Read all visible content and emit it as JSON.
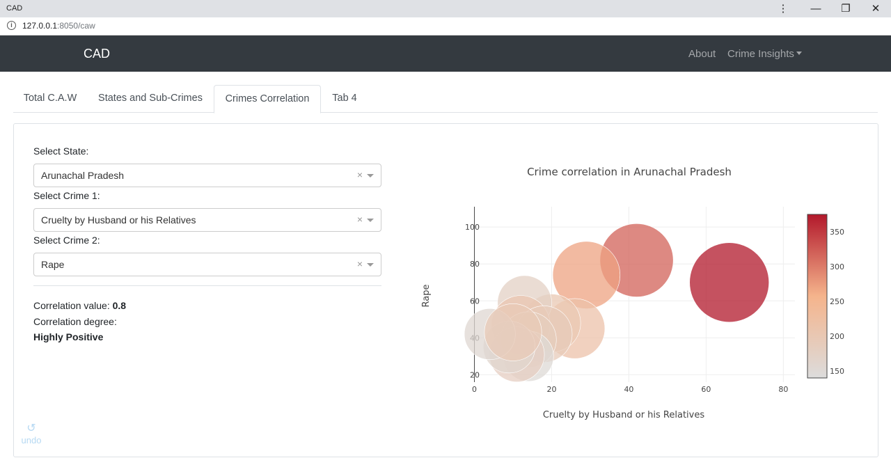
{
  "window": {
    "title": "CAD"
  },
  "browser": {
    "url_host": "127.0.0.1",
    "url_path": ":8050/caw"
  },
  "navbar": {
    "brand": "CAD",
    "about": "About",
    "insights": "Crime Insights"
  },
  "tabs": [
    {
      "label": "Total C.A.W"
    },
    {
      "label": "States and Sub-Crimes"
    },
    {
      "label": "Crimes Correlation"
    },
    {
      "label": "Tab 4"
    }
  ],
  "form": {
    "state_label": "Select State:",
    "state_value": "Arunachal Pradesh",
    "crime1_label": "Select Crime 1:",
    "crime1_value": "Cruelty by Husband or his Relatives",
    "crime2_label": "Select Crime 2:",
    "crime2_value": "Rape",
    "clear_glyph": "×"
  },
  "result": {
    "corr_label": "Correlation value: ",
    "corr_value": "0.8",
    "degree_label": "Correlation degree:",
    "degree_value": "Highly Positive"
  },
  "undo": {
    "label": "undo"
  },
  "chart_data": {
    "type": "scatter",
    "title": "Crime correlation in Arunachal Pradesh",
    "xlabel": "Cruelty by Husband or his Relatives",
    "ylabel": "Rape",
    "xlim": [
      -1,
      83
    ],
    "ylim": [
      16,
      111
    ],
    "xticks": [
      0,
      20,
      40,
      60,
      80
    ],
    "yticks": [
      20,
      40,
      60,
      80,
      100
    ],
    "colorbar": {
      "range": [
        140,
        375
      ],
      "ticks": [
        150,
        200,
        250,
        300,
        350
      ]
    },
    "colorscale": [
      "#dcdcdc",
      "#f5b48c",
      "#b2182b"
    ],
    "points": [
      {
        "x": 66,
        "y": 70,
        "size": 375
      },
      {
        "x": 42,
        "y": 82,
        "size": 320
      },
      {
        "x": 29,
        "y": 74,
        "size": 270
      },
      {
        "x": 26,
        "y": 45,
        "size": 215
      },
      {
        "x": 20,
        "y": 48,
        "size": 200
      },
      {
        "x": 13,
        "y": 59,
        "size": 175
      },
      {
        "x": 12,
        "y": 47,
        "size": 205
      },
      {
        "x": 18,
        "y": 42,
        "size": 190
      },
      {
        "x": 14,
        "y": 39,
        "size": 185
      },
      {
        "x": 14,
        "y": 30,
        "size": 150
      },
      {
        "x": 11,
        "y": 31,
        "size": 180
      },
      {
        "x": 9,
        "y": 35,
        "size": 160
      },
      {
        "x": 4,
        "y": 42,
        "size": 155
      },
      {
        "x": 10,
        "y": 43,
        "size": 195
      }
    ]
  }
}
